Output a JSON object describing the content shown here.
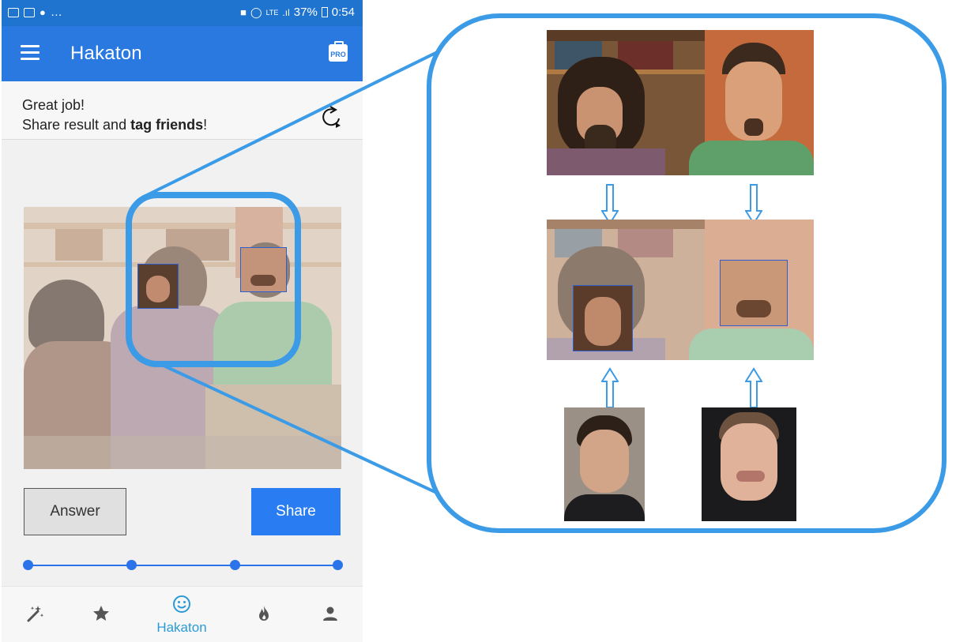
{
  "status_bar": {
    "network": "LTE",
    "battery": "37%",
    "time": "0:54"
  },
  "app_bar": {
    "title": "Hakaton",
    "pro_label": "PRO"
  },
  "message": {
    "line1": "Great job!",
    "line2_prefix": "Share result and ",
    "line2_bold": "tag friends",
    "line2_suffix": "!"
  },
  "actions": {
    "answer_label": "Answer",
    "share_label": "Share"
  },
  "progress": {
    "steps": 4,
    "current": 4
  },
  "bottom_nav": {
    "items": [
      {
        "icon": "magic-wand-icon",
        "label": ""
      },
      {
        "icon": "star-icon",
        "label": ""
      },
      {
        "icon": "smiley-icon",
        "label": "Hakaton",
        "active": true
      },
      {
        "icon": "fire-icon",
        "label": ""
      },
      {
        "icon": "person-icon",
        "label": ""
      }
    ]
  },
  "colors": {
    "primary": "#2979e0",
    "status_bar": "#1f74d0",
    "accent": "#2a9bd8",
    "highlight": "#3b9be6",
    "share_button": "#2a7cf3"
  }
}
